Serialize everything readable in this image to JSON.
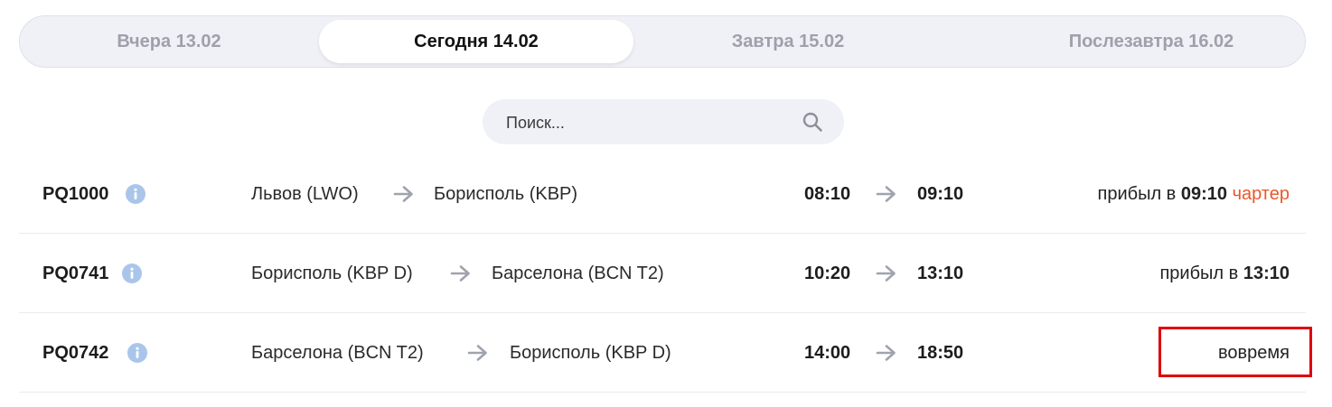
{
  "tabs": [
    {
      "label": "Вчера 13.02",
      "active": false
    },
    {
      "label": "Сегодня 14.02",
      "active": true
    },
    {
      "label": "Завтра 15.02",
      "active": false
    },
    {
      "label": "Послезавтра 16.02",
      "active": false
    }
  ],
  "search": {
    "placeholder": "Поиск...",
    "value": ""
  },
  "flights": [
    {
      "number": "PQ1000",
      "from": "Львов (LWO)",
      "to": "Борисполь (KBP)",
      "departure": "08:10",
      "arrival": "09:10",
      "status_prefix": "прибыл в",
      "status_time": "09:10",
      "status_tag": "чартер"
    },
    {
      "number": "PQ0741",
      "from": "Борисполь (KBP D)",
      "to": "Барселона (BCN T2)",
      "departure": "10:20",
      "arrival": "13:10",
      "status_prefix": "прибыл в",
      "status_time": "13:10"
    },
    {
      "number": "PQ0742",
      "from": "Барселона (BCN T2)",
      "to": "Борисполь (KBP D)",
      "departure": "14:00",
      "arrival": "18:50",
      "status_prefix": "вовремя"
    }
  ],
  "colors": {
    "tab_bar_bg": "#f0f1f6",
    "info_icon": "#a9c6ea",
    "arrow": "#9fa3ad",
    "charter": "#e8582a",
    "highlight_border": "#e0000b"
  },
  "icons": {
    "search": "search-icon",
    "info": "info-icon",
    "arrow": "arrow-right-icon"
  }
}
